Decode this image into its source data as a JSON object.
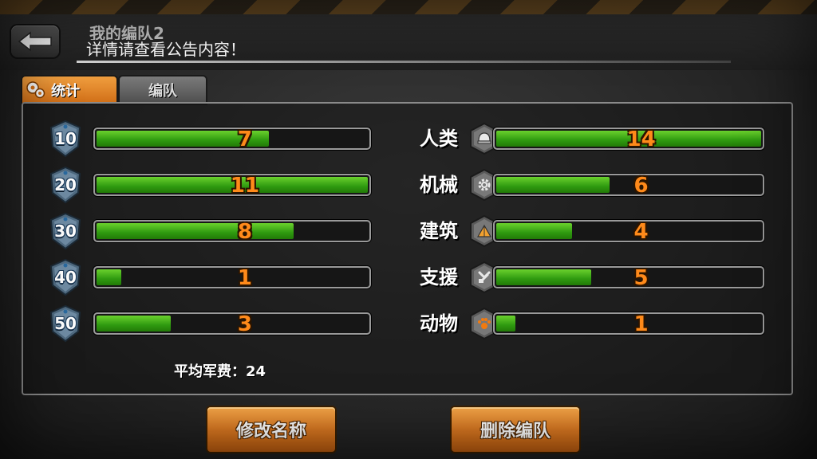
{
  "header": {
    "title": "我的编队2",
    "notice": "详情请查看公告内容！"
  },
  "tabs": [
    {
      "label": "统计",
      "active": true
    },
    {
      "label": "编队",
      "active": false
    }
  ],
  "cost_stats": {
    "max": 11,
    "rows": [
      {
        "cost": "10",
        "count": 7
      },
      {
        "cost": "20",
        "count": 11
      },
      {
        "cost": "30",
        "count": 8
      },
      {
        "cost": "40",
        "count": 1
      },
      {
        "cost": "50",
        "count": 3
      }
    ]
  },
  "type_stats": {
    "max": 14,
    "rows": [
      {
        "label": "人类",
        "icon": "helmet-icon",
        "count": 14
      },
      {
        "label": "机械",
        "icon": "gear-icon",
        "count": 6
      },
      {
        "label": "建筑",
        "icon": "tent-icon",
        "count": 4
      },
      {
        "label": "支援",
        "icon": "wrench-icon",
        "count": 5
      },
      {
        "label": "动物",
        "icon": "paw-icon",
        "count": 1
      }
    ]
  },
  "average": {
    "label": "平均军费：",
    "value": "24"
  },
  "buttons": {
    "rename": "修改名称",
    "delete": "删除编队"
  },
  "colors": {
    "accent": "#e0822a",
    "bar_fill": "#4cb81e",
    "value_text": "#ff8a1a"
  }
}
